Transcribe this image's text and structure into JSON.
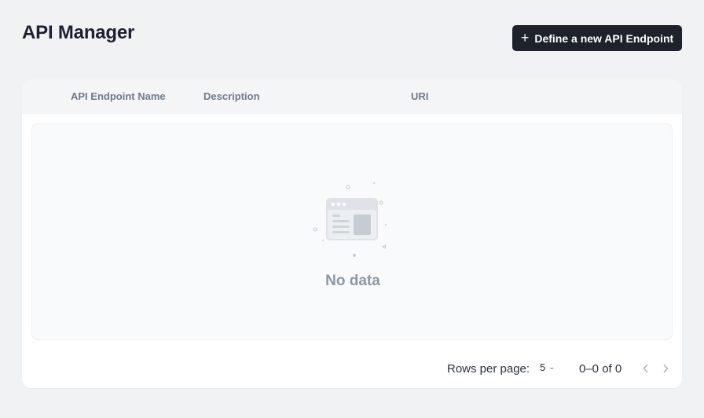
{
  "header": {
    "title": "API Manager",
    "define_button_label": "Define a new API Endpoint"
  },
  "table": {
    "columns": [
      "API Endpoint Name",
      "Description",
      "URI"
    ],
    "rows": [],
    "empty_text": "No data"
  },
  "pagination": {
    "rows_per_page_label": "Rows per page:",
    "rows_per_page_value": "5",
    "range_text": "0–0 of 0"
  },
  "icons": {
    "define_button": "plus-icon",
    "empty_state": "empty-browser-window-icon",
    "rows_select": "chevron-down-icon",
    "prev": "chevron-left-icon",
    "next": "chevron-right-icon"
  },
  "colors": {
    "primary_button": "#1d222b",
    "page_background": "#f0f2f4",
    "header_background": "#f3f5f7",
    "muted_text": "#8d97a5"
  }
}
